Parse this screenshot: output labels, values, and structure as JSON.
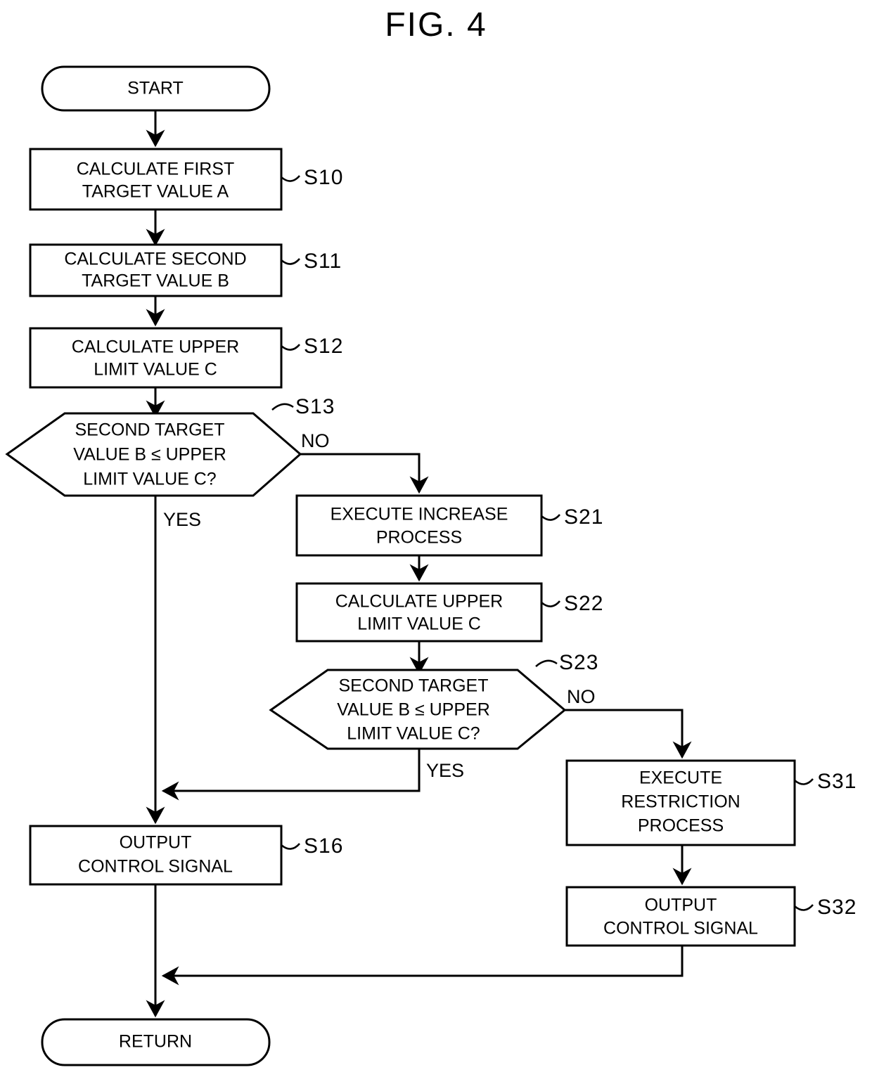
{
  "figure": {
    "title": "FIG. 4",
    "type": "flowchart"
  },
  "nodes": {
    "start": {
      "label": "START",
      "shape": "terminator"
    },
    "s10": {
      "label_line1": "CALCULATE FIRST",
      "label_line2": "TARGET VALUE A",
      "tag": "S10",
      "shape": "process"
    },
    "s11": {
      "label_line1": "CALCULATE SECOND",
      "label_line2": "TARGET VALUE B",
      "tag": "S11",
      "shape": "process"
    },
    "s12": {
      "label_line1": "CALCULATE UPPER",
      "label_line2": "LIMIT VALUE C",
      "tag": "S12",
      "shape": "process"
    },
    "s13": {
      "label_line1": "SECOND TARGET",
      "label_line2": "VALUE B ≤ UPPER",
      "label_line3": "LIMIT VALUE C?",
      "tag": "S13",
      "shape": "decision",
      "yes_label": "YES",
      "no_label": "NO"
    },
    "s21": {
      "label_line1": "EXECUTE INCREASE",
      "label_line2": "PROCESS",
      "tag": "S21",
      "shape": "process"
    },
    "s22": {
      "label_line1": "CALCULATE UPPER",
      "label_line2": "LIMIT VALUE C",
      "tag": "S22",
      "shape": "process"
    },
    "s23": {
      "label_line1": "SECOND TARGET",
      "label_line2": "VALUE B ≤ UPPER",
      "label_line3": "LIMIT VALUE C?",
      "tag": "S23",
      "shape": "decision",
      "yes_label": "YES",
      "no_label": "NO"
    },
    "s31": {
      "label_line1": "EXECUTE",
      "label_line2": "RESTRICTION",
      "label_line3": "PROCESS",
      "tag": "S31",
      "shape": "process"
    },
    "s32": {
      "label_line1": "OUTPUT",
      "label_line2": "CONTROL SIGNAL",
      "tag": "S32",
      "shape": "process"
    },
    "s16": {
      "label_line1": "OUTPUT",
      "label_line2": "CONTROL SIGNAL",
      "tag": "S16",
      "shape": "process"
    },
    "return": {
      "label": "RETURN",
      "shape": "terminator"
    }
  },
  "colors": {
    "stroke": "#000000",
    "fill": "#ffffff",
    "text": "#000000"
  }
}
